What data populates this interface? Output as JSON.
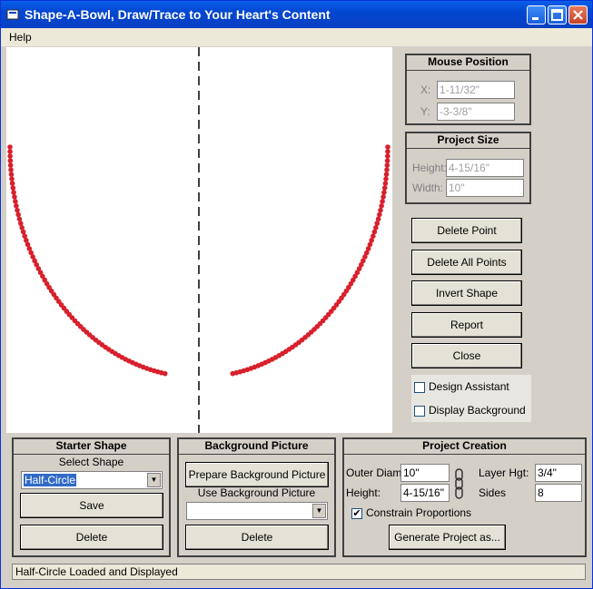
{
  "window": {
    "title": "Shape-A-Bowl, Draw/Trace to Your Heart's Content"
  },
  "menu": {
    "help": "Help"
  },
  "colors": {
    "curve_point": "#d8202c",
    "curve_line": "#3a2a8c",
    "title_bar": "#0a3fc2"
  },
  "mouse_position": {
    "title": "Mouse Position",
    "x_label": "X:",
    "x_value": "1-11/32\"",
    "y_label": "Y:",
    "y_value": "-3-3/8\""
  },
  "project_size": {
    "title": "Project Size",
    "height_label": "Height:",
    "height_value": "4-15/16\"",
    "width_label": "Width:",
    "width_value": "10\""
  },
  "actions": {
    "delete_point": "Delete Point",
    "delete_all_points": "Delete All Points",
    "invert_shape": "Invert Shape",
    "report": "Report",
    "close": "Close"
  },
  "options": {
    "design_assistant": "Design Assistant",
    "design_assistant_checked": false,
    "display_background": "Display Background",
    "display_background_checked": false
  },
  "starter_shape": {
    "title": "Starter Shape",
    "select_label": "Select Shape",
    "selected": "Half-Circle",
    "save": "Save",
    "delete": "Delete"
  },
  "background_picture": {
    "title": "Background Picture",
    "prepare": "Prepare Background Picture",
    "use_label": "Use Background Picture",
    "selected": "",
    "delete": "Delete"
  },
  "project_creation": {
    "title": "Project Creation",
    "outer_diam_label": "Outer Diam.:",
    "outer_diam_value": "10\"",
    "height_label": "Height:",
    "height_value": "4-15/16\"",
    "layer_hgt_label": "Layer Hgt:",
    "layer_hgt_value": "3/4\"",
    "sides_label": "Sides",
    "sides_value": "8",
    "constrain_label": "Constrain Proportions",
    "constrain_checked": true,
    "generate": "Generate Project as..."
  },
  "status": {
    "text": "Half-Circle Loaded and Displayed"
  }
}
